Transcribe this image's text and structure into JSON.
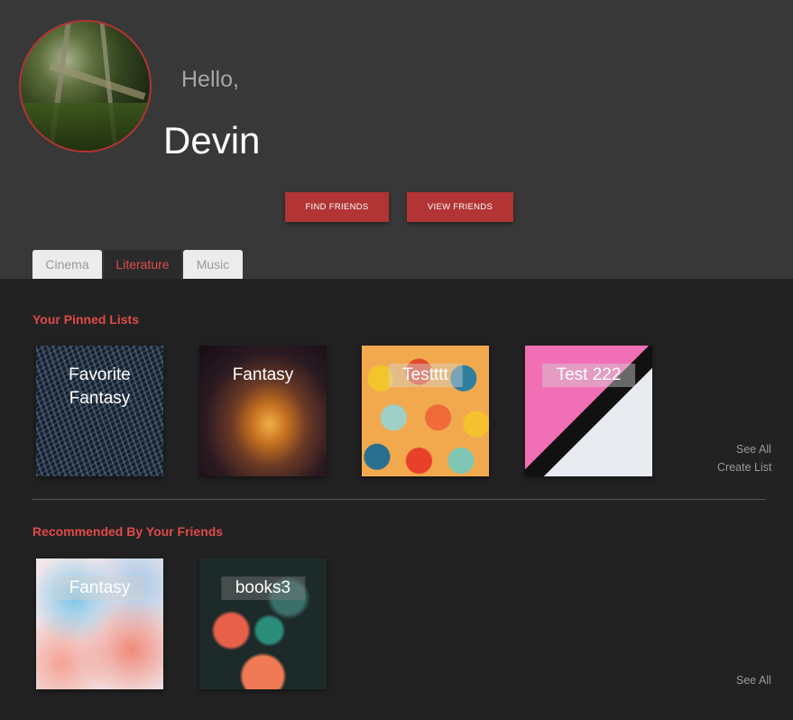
{
  "profile": {
    "greeting": "Hello,",
    "name": "Devin"
  },
  "actions": {
    "find_friends": "FIND FRIENDS",
    "view_friends": "VIEW FRIENDS"
  },
  "tabs": [
    {
      "label": "Cinema",
      "active": false
    },
    {
      "label": "Literature",
      "active": true
    },
    {
      "label": "Music",
      "active": false
    }
  ],
  "pinned": {
    "title": "Your Pinned Lists",
    "lists": [
      {
        "label": "Favorite Fantasy"
      },
      {
        "label": "Fantasy"
      },
      {
        "label": "Testttt"
      },
      {
        "label": "Test 222"
      }
    ],
    "see_all": "See All",
    "create_list": "Create List"
  },
  "recommended": {
    "title": "Recommended By Your Friends",
    "lists": [
      {
        "label": "Fantasy"
      },
      {
        "label": "books3"
      }
    ],
    "see_all": "See All"
  },
  "colors": {
    "accent": "#b23434",
    "accent_text": "#e04a4a",
    "header_bg": "#383838",
    "body_bg": "#222222"
  }
}
